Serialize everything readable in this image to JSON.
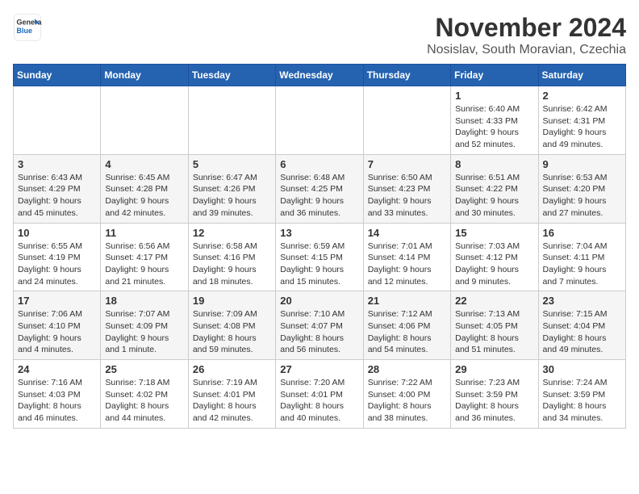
{
  "header": {
    "logo_line1": "General",
    "logo_line2": "Blue",
    "month": "November 2024",
    "location": "Nosislav, South Moravian, Czechia"
  },
  "days_of_week": [
    "Sunday",
    "Monday",
    "Tuesday",
    "Wednesday",
    "Thursday",
    "Friday",
    "Saturday"
  ],
  "weeks": [
    [
      {
        "day": "",
        "info": ""
      },
      {
        "day": "",
        "info": ""
      },
      {
        "day": "",
        "info": ""
      },
      {
        "day": "",
        "info": ""
      },
      {
        "day": "",
        "info": ""
      },
      {
        "day": "1",
        "info": "Sunrise: 6:40 AM\nSunset: 4:33 PM\nDaylight: 9 hours\nand 52 minutes."
      },
      {
        "day": "2",
        "info": "Sunrise: 6:42 AM\nSunset: 4:31 PM\nDaylight: 9 hours\nand 49 minutes."
      }
    ],
    [
      {
        "day": "3",
        "info": "Sunrise: 6:43 AM\nSunset: 4:29 PM\nDaylight: 9 hours\nand 45 minutes."
      },
      {
        "day": "4",
        "info": "Sunrise: 6:45 AM\nSunset: 4:28 PM\nDaylight: 9 hours\nand 42 minutes."
      },
      {
        "day": "5",
        "info": "Sunrise: 6:47 AM\nSunset: 4:26 PM\nDaylight: 9 hours\nand 39 minutes."
      },
      {
        "day": "6",
        "info": "Sunrise: 6:48 AM\nSunset: 4:25 PM\nDaylight: 9 hours\nand 36 minutes."
      },
      {
        "day": "7",
        "info": "Sunrise: 6:50 AM\nSunset: 4:23 PM\nDaylight: 9 hours\nand 33 minutes."
      },
      {
        "day": "8",
        "info": "Sunrise: 6:51 AM\nSunset: 4:22 PM\nDaylight: 9 hours\nand 30 minutes."
      },
      {
        "day": "9",
        "info": "Sunrise: 6:53 AM\nSunset: 4:20 PM\nDaylight: 9 hours\nand 27 minutes."
      }
    ],
    [
      {
        "day": "10",
        "info": "Sunrise: 6:55 AM\nSunset: 4:19 PM\nDaylight: 9 hours\nand 24 minutes."
      },
      {
        "day": "11",
        "info": "Sunrise: 6:56 AM\nSunset: 4:17 PM\nDaylight: 9 hours\nand 21 minutes."
      },
      {
        "day": "12",
        "info": "Sunrise: 6:58 AM\nSunset: 4:16 PM\nDaylight: 9 hours\nand 18 minutes."
      },
      {
        "day": "13",
        "info": "Sunrise: 6:59 AM\nSunset: 4:15 PM\nDaylight: 9 hours\nand 15 minutes."
      },
      {
        "day": "14",
        "info": "Sunrise: 7:01 AM\nSunset: 4:14 PM\nDaylight: 9 hours\nand 12 minutes."
      },
      {
        "day": "15",
        "info": "Sunrise: 7:03 AM\nSunset: 4:12 PM\nDaylight: 9 hours\nand 9 minutes."
      },
      {
        "day": "16",
        "info": "Sunrise: 7:04 AM\nSunset: 4:11 PM\nDaylight: 9 hours\nand 7 minutes."
      }
    ],
    [
      {
        "day": "17",
        "info": "Sunrise: 7:06 AM\nSunset: 4:10 PM\nDaylight: 9 hours\nand 4 minutes."
      },
      {
        "day": "18",
        "info": "Sunrise: 7:07 AM\nSunset: 4:09 PM\nDaylight: 9 hours\nand 1 minute."
      },
      {
        "day": "19",
        "info": "Sunrise: 7:09 AM\nSunset: 4:08 PM\nDaylight: 8 hours\nand 59 minutes."
      },
      {
        "day": "20",
        "info": "Sunrise: 7:10 AM\nSunset: 4:07 PM\nDaylight: 8 hours\nand 56 minutes."
      },
      {
        "day": "21",
        "info": "Sunrise: 7:12 AM\nSunset: 4:06 PM\nDaylight: 8 hours\nand 54 minutes."
      },
      {
        "day": "22",
        "info": "Sunrise: 7:13 AM\nSunset: 4:05 PM\nDaylight: 8 hours\nand 51 minutes."
      },
      {
        "day": "23",
        "info": "Sunrise: 7:15 AM\nSunset: 4:04 PM\nDaylight: 8 hours\nand 49 minutes."
      }
    ],
    [
      {
        "day": "24",
        "info": "Sunrise: 7:16 AM\nSunset: 4:03 PM\nDaylight: 8 hours\nand 46 minutes."
      },
      {
        "day": "25",
        "info": "Sunrise: 7:18 AM\nSunset: 4:02 PM\nDaylight: 8 hours\nand 44 minutes."
      },
      {
        "day": "26",
        "info": "Sunrise: 7:19 AM\nSunset: 4:01 PM\nDaylight: 8 hours\nand 42 minutes."
      },
      {
        "day": "27",
        "info": "Sunrise: 7:20 AM\nSunset: 4:01 PM\nDaylight: 8 hours\nand 40 minutes."
      },
      {
        "day": "28",
        "info": "Sunrise: 7:22 AM\nSunset: 4:00 PM\nDaylight: 8 hours\nand 38 minutes."
      },
      {
        "day": "29",
        "info": "Sunrise: 7:23 AM\nSunset: 3:59 PM\nDaylight: 8 hours\nand 36 minutes."
      },
      {
        "day": "30",
        "info": "Sunrise: 7:24 AM\nSunset: 3:59 PM\nDaylight: 8 hours\nand 34 minutes."
      }
    ]
  ]
}
